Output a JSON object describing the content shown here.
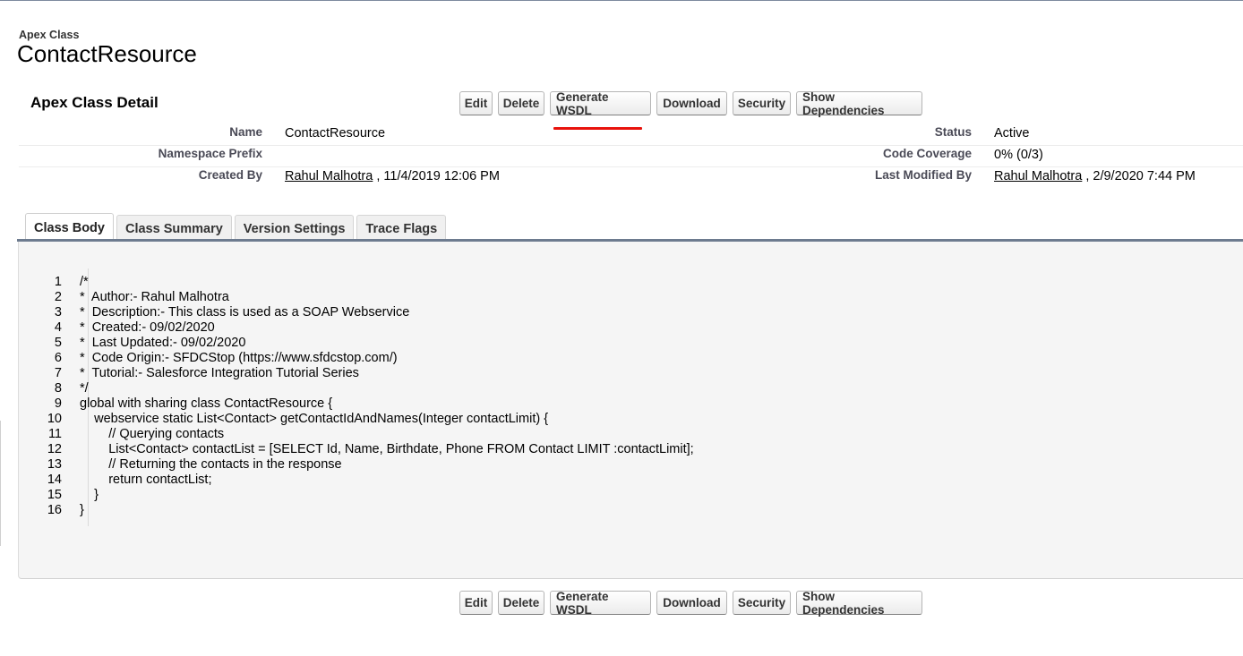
{
  "header": {
    "object_type": "Apex Class",
    "record_name": "ContactResource"
  },
  "detail": {
    "section_title": "Apex Class Detail",
    "buttons": [
      "Edit",
      "Delete",
      "Generate WSDL",
      "Download",
      "Security",
      "Show Dependencies"
    ],
    "fields": {
      "name_label": "Name",
      "name_value": "ContactResource",
      "status_label": "Status",
      "status_value": "Active",
      "namespace_label": "Namespace Prefix",
      "namespace_value": "",
      "coverage_label": "Code Coverage",
      "coverage_value": "0% (0/3)",
      "created_label": "Created By",
      "created_user": "Rahul Malhotra",
      "created_date": ", 11/4/2019 12:06 PM",
      "modified_label": "Last Modified By",
      "modified_user": "Rahul Malhotra",
      "modified_date": ", 2/9/2020 7:44 PM"
    },
    "annotation_color": "#e8120c"
  },
  "tabs": [
    "Class Body",
    "Class Summary",
    "Version Settings",
    "Trace Flags"
  ],
  "active_tab": "Class Body",
  "code": {
    "line_numbers": [
      "1",
      "2",
      "3",
      "4",
      "5",
      "6",
      "7",
      "8",
      "9",
      "10",
      "11",
      "12",
      "13",
      "14",
      "15",
      "16"
    ],
    "lines": [
      "/*",
      "*  Author:- Rahul Malhotra",
      "*  Description:- This class is used as a SOAP Webservice",
      "*  Created:- 09/02/2020",
      "*  Last Updated:- 09/02/2020",
      "*  Code Origin:- SFDCStop (https://www.sfdcstop.com/)",
      "*  Tutorial:- Salesforce Integration Tutorial Series",
      "*/",
      "global with sharing class ContactResource {",
      "    webservice static List<Contact> getContactIdAndNames(Integer contactLimit) {",
      "        // Querying contacts",
      "        List<Contact> contactList = [SELECT Id, Name, Birthdate, Phone FROM Contact LIMIT :contactLimit];",
      "        // Returning the contacts in the response",
      "        return contactList;",
      "    }",
      "}"
    ]
  }
}
